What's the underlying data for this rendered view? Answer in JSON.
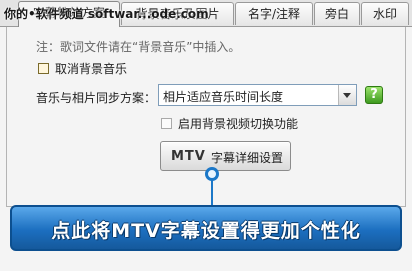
{
  "tabs": [
    {
      "label": "字幕特效方案"
    },
    {
      "label": "背景音乐及图片"
    },
    {
      "label": "名字/注释"
    },
    {
      "label": "旁白"
    },
    {
      "label": "水印"
    }
  ],
  "watermark": "你的•软件频道 softwar...ode.com",
  "note": "注：歌词文件请在“背景音乐”中插入。",
  "cancel_bg_music": {
    "label": "取消背景音乐",
    "checked": false
  },
  "sync": {
    "label": "音乐与相片同步方案：",
    "value": "相片适应音乐时间长度",
    "help": "?"
  },
  "bg_video_switch": {
    "label": "启用背景视频切换功能",
    "checked": false,
    "enabled": false
  },
  "mtv_button": {
    "logo": "MTV",
    "label": "字幕详细设置"
  },
  "callout": {
    "text": "点此将MTV字幕设置得更加个性化"
  },
  "colors": {
    "accent": "#1c6fc0",
    "help_green": "#4caf25"
  }
}
